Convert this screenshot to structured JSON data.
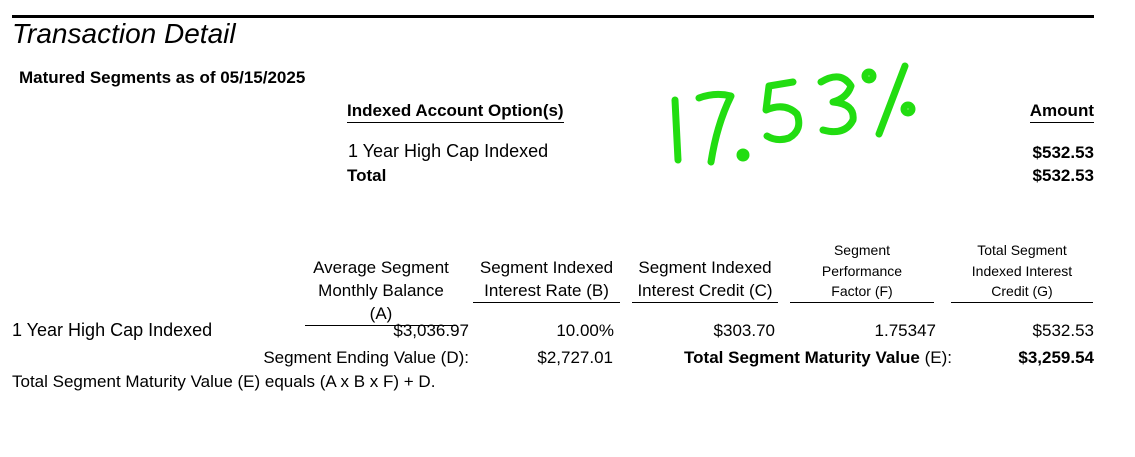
{
  "header": {
    "title": "Transaction Detail",
    "subtitle": "Matured Segments as of 05/15/2025"
  },
  "summary": {
    "option_header": "Indexed Account Option(s)",
    "amount_header": "Amount",
    "rows": [
      {
        "option": "1 Year High Cap Indexed",
        "amount": "$532.53"
      }
    ],
    "total_label": "Total",
    "total_amount": "$532.53"
  },
  "annotation": {
    "handwritten_text": "17.53%",
    "color": "#22dd11"
  },
  "detail": {
    "columns": {
      "a": [
        "Average Segment",
        "Monthly Balance (A)"
      ],
      "b": [
        "Segment Indexed",
        "Interest Rate (B)"
      ],
      "c": [
        "Segment Indexed",
        "Interest Credit (C)"
      ],
      "f": [
        "Segment",
        "Performance",
        "Factor (F)"
      ],
      "g": [
        "Total Segment",
        "Indexed Interest",
        "Credit (G)"
      ]
    },
    "row": {
      "label": "1 Year High Cap Indexed",
      "a": "$3,036.97",
      "b": "10.00%",
      "c": "$303.70",
      "f": "1.75347",
      "g": "$532.53"
    },
    "ending_value_label": "Segment Ending Value (D):",
    "ending_value": "$2,727.01",
    "maturity_label": "Total Segment Maturity Value",
    "maturity_label_suffix": "(E):",
    "maturity_value": "$3,259.54",
    "formula": "Total Segment Maturity Value (E) equals (A x B x F) + D."
  }
}
